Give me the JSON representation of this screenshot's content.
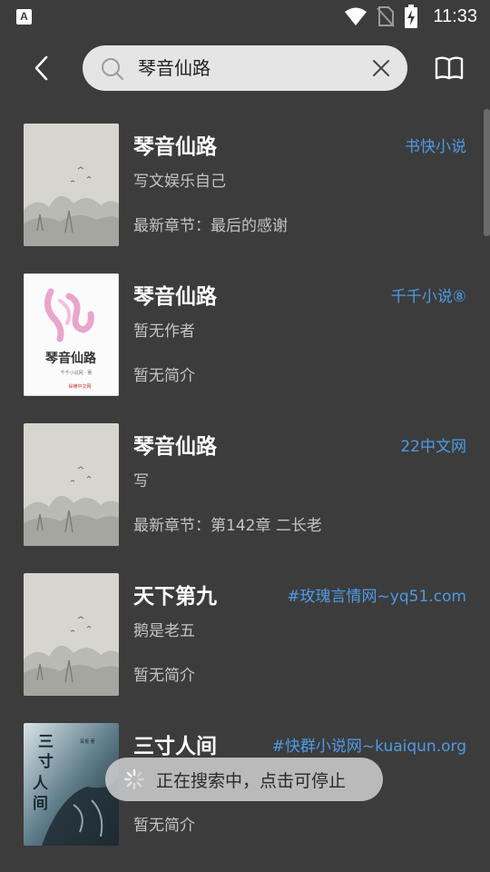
{
  "status_bar": {
    "notification_icon": "A",
    "time": "11:33",
    "icons": [
      "wifi-icon",
      "no-sim-icon",
      "battery-charging-icon"
    ]
  },
  "toolbar": {
    "back_icon": "chevron-left-icon",
    "search_value": "琴音仙路",
    "search_icon": "search-icon",
    "clear_icon": "close-icon",
    "bookshelf_icon": "open-book-icon"
  },
  "results": [
    {
      "title": "琴音仙路",
      "source": "书快小说",
      "author": "写文娱乐自己",
      "desc": "最新章节：最后的感谢",
      "cover": "ink-landscape"
    },
    {
      "title": "琴音仙路",
      "source": "千千小说⑧",
      "author": "暂无作者",
      "desc": "暂无简介",
      "cover": "pink-title-cover",
      "cover_title": "琴音仙路",
      "cover_sub": "千千小说网 · 著",
      "cover_brand": "纵横中文网"
    },
    {
      "title": "琴音仙路",
      "source": "22中文网",
      "author": "写",
      "desc": "最新章节：第142章 二长老",
      "cover": "ink-landscape"
    },
    {
      "title": "天下第九",
      "source": "#玫瑰言情网~yq51.com",
      "author": "鹅是老五",
      "desc": "暂无简介",
      "cover": "ink-landscape"
    },
    {
      "title": "三寸人间",
      "source": "#快群小说网~kuaiqun.org",
      "author": "",
      "desc": "暂无简介",
      "cover": "dark-ink-cover",
      "cover_title": "三寸人间",
      "cover_author": "耳根 著"
    }
  ],
  "toast": {
    "text": "正在搜索中，点击可停止",
    "icon": "loading-spinner-icon"
  },
  "colors": {
    "background": "#3c3c3c",
    "accent": "#4d9ae6",
    "search_bg": "#e5e5e5"
  }
}
